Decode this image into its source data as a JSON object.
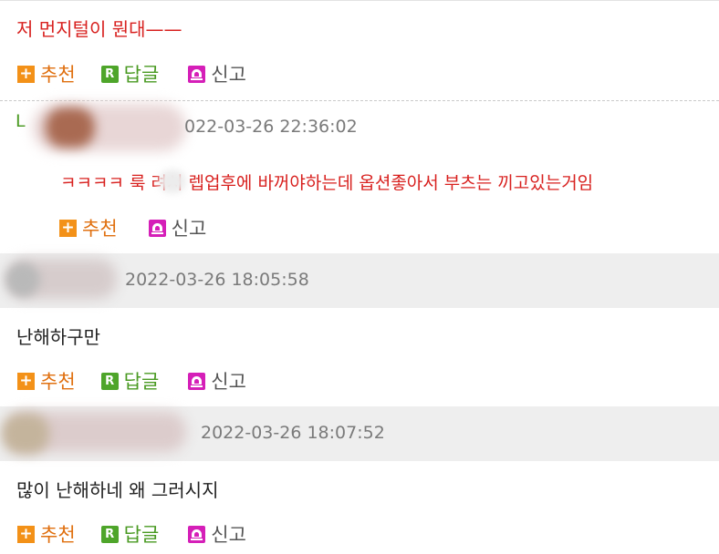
{
  "comments": [
    {
      "text": "저 먼지털이 뭔대——"
    },
    {
      "author_initial": "L",
      "timestamp": "022-03-26 22:36:02",
      "text": "ㅋㅋㅋㅋ 룩  려서 렙업후에 바꺼야하는데 옵션좋아서 부츠는 끼고있는거임"
    },
    {
      "timestamp": "2022-03-26 18:05:58",
      "text": "난해하구만"
    },
    {
      "timestamp": "2022-03-26 18:07:52",
      "text": "많이 난해하네 왜 그러시지"
    }
  ],
  "actions": {
    "recommend": "추천",
    "reply": "답글",
    "report": "신고"
  },
  "colors": {
    "recommend": "#f39118",
    "reply": "#4ea52a",
    "report": "#d51fb8",
    "reply_text": "#d8211f",
    "header_band": "#eeeeee"
  }
}
